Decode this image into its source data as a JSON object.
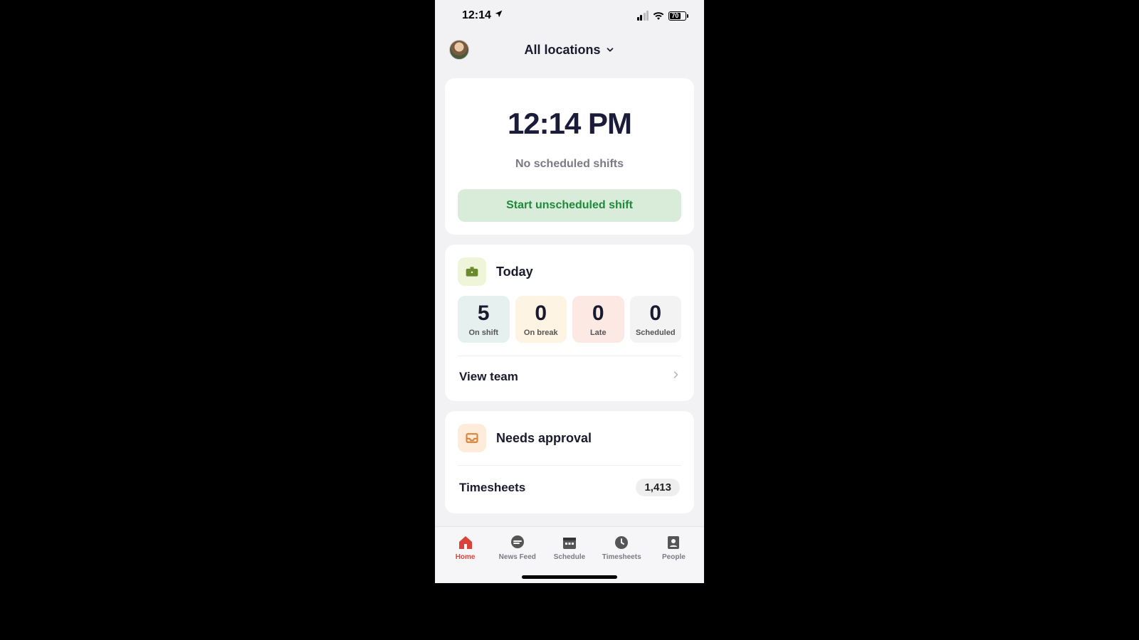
{
  "status_bar": {
    "time": "12:14",
    "battery_pct": "70"
  },
  "header": {
    "location_label": "All locations"
  },
  "clock_card": {
    "time": "12:14 PM",
    "subtitle": "No scheduled shifts",
    "start_button": "Start unscheduled shift"
  },
  "today": {
    "title": "Today",
    "stats": [
      {
        "value": "5",
        "label": "On shift"
      },
      {
        "value": "0",
        "label": "On break"
      },
      {
        "value": "0",
        "label": "Late"
      },
      {
        "value": "0",
        "label": "Scheduled"
      }
    ],
    "view_team": "View team"
  },
  "approval": {
    "title": "Needs approval",
    "row_label": "Timesheets",
    "row_count": "1,413"
  },
  "tabs": {
    "home": "Home",
    "news": "News Feed",
    "schedule": "Schedule",
    "timesheets": "Timesheets",
    "people": "People"
  }
}
